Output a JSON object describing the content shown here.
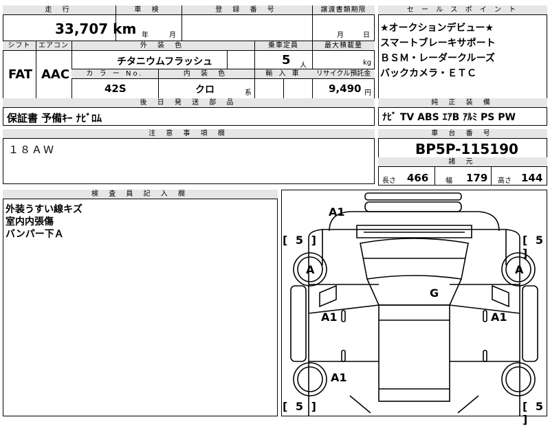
{
  "top_row": {
    "mileage_label": "走 行",
    "mileage_value": "33,707",
    "mileage_unit": "km",
    "shaken_label": "車 検",
    "shaken_year": "年",
    "shaken_month": "月",
    "reg_label": "登 録 番 号",
    "transfer_label": "譲渡書類期限",
    "transfer_month": "月",
    "transfer_day": "日"
  },
  "row2": {
    "shift_label": "シフト",
    "shift_value": "FAT",
    "ac_label": "エアコン",
    "ac_value": "AAC",
    "exterior_label": "外 装 色",
    "exterior_value": "チタニウムフラッシュ",
    "capacity_label": "乗車定員",
    "capacity_value": "5",
    "capacity_unit": "人",
    "maxload_label": "最大積載量",
    "maxload_unit": "kg",
    "color_no_label": "カ ラ ー No.",
    "color_no_value": "42S",
    "interior_label": "内 装 色",
    "interior_value": "クロ",
    "interior_suffix": "系",
    "import_label": "輸 入 車",
    "recycle_label": "リサイクル預託金",
    "recycle_value": "9,490",
    "recycle_unit": "円"
  },
  "shipping": {
    "label": "後 日 発 送 部 品",
    "value": "保証書  予備ｷｰ  ﾅﾋﾞﾛﾑ"
  },
  "notes": {
    "label": "注 意 事 項 欄",
    "value": "１８ＡＷ"
  },
  "sales_points": {
    "label": "セ ー ル ス ポ イ ン ト",
    "lines": [
      "★オークションデビュー★",
      "スマートブレーキサポート",
      "ＢＳＭ・レーダークルーズ",
      "バックカメラ・ＥＴＣ"
    ]
  },
  "equipment": {
    "label": "純 正 装 備",
    "value": "ﾅﾋﾞ  TV  ABS  ｴｱB  ｱﾙﾐ  PS  PW"
  },
  "chassis": {
    "label": "車 台 番 号",
    "value": "BP5P-115190"
  },
  "specs": {
    "label": "諸 元",
    "length_label": "長さ",
    "length_value": "466",
    "width_label": "幅",
    "width_value": "179",
    "height_label": "高さ",
    "height_value": "144"
  },
  "inspector": {
    "label": "検 査 員 記 入 欄",
    "lines": [
      "外装うすい線キズ",
      "室内内張傷",
      "バンパー下Ａ"
    ]
  },
  "diagram": {
    "marks": {
      "front_bumper": "A1",
      "windshield": "G",
      "left_front_door": "A1",
      "right_front_door": "A1",
      "left_front_wheel": "A",
      "right_front_wheel": "A",
      "left_rear_wheel_area": "A1"
    },
    "tread": {
      "front_left": "5",
      "front_right": "5",
      "rear_left": "5",
      "rear_right": "5"
    }
  }
}
